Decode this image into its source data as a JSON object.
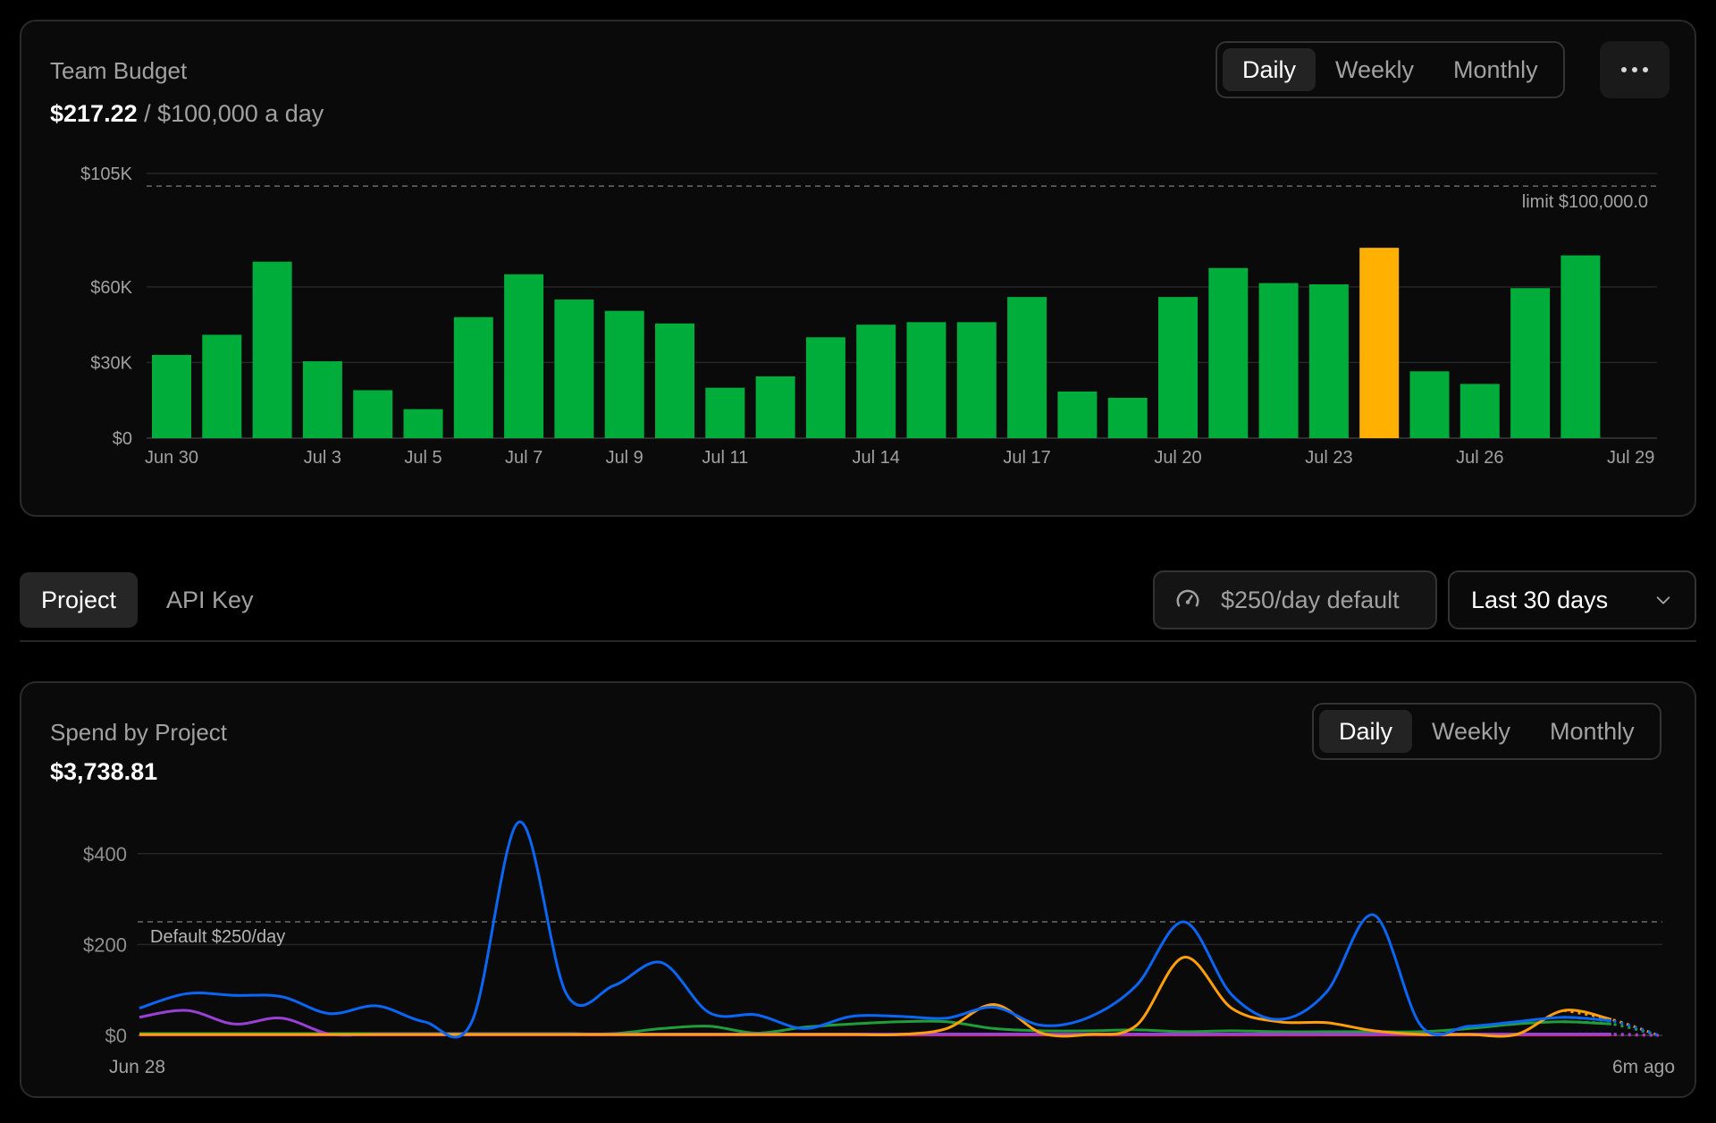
{
  "budget": {
    "title": "Team Budget",
    "spent": "$217.22",
    "separator": " / ",
    "limit_text": "$100,000 a day",
    "period_options": [
      "Daily",
      "Weekly",
      "Monthly"
    ],
    "active_period": "Daily",
    "more_icon": "ellipsis-icon"
  },
  "tabs": {
    "items": [
      "Project",
      "API Key"
    ],
    "active": "Project"
  },
  "limit_pill": {
    "label": "$250/day default",
    "icon": "gauge-icon"
  },
  "range_select": {
    "value": "Last 30 days",
    "icon": "chevron-down-icon"
  },
  "spend": {
    "title": "Spend by Project",
    "total": "$3,738.81",
    "period_options": [
      "Daily",
      "Weekly",
      "Monthly"
    ],
    "active_period": "Daily"
  },
  "colors": {
    "bar_normal": "#00ad3a",
    "bar_highlight": "#ffb000",
    "series_blue": "#0a66f5",
    "series_orange": "#ff9f0a",
    "series_purple": "#9b3fd6",
    "series_green": "#1f9e3a",
    "series_pink": "#e0227a"
  },
  "chart_data": [
    {
      "type": "bar",
      "categories": [
        "Jun 30",
        "Jul 1",
        "Jul 2",
        "Jul 3",
        "Jul 4",
        "Jul 5",
        "Jul 6",
        "Jul 7",
        "Jul 8",
        "Jul 9",
        "Jul 10",
        "Jul 11",
        "Jul 12",
        "Jul 13",
        "Jul 14",
        "Jul 15",
        "Jul 16",
        "Jul 17",
        "Jul 18",
        "Jul 19",
        "Jul 20",
        "Jul 21",
        "Jul 22",
        "Jul 23",
        "Jul 24",
        "Jul 25",
        "Jul 26",
        "Jul 27",
        "Jul 28",
        "Jul 29"
      ],
      "values": [
        33000,
        41000,
        70000,
        30500,
        19000,
        11500,
        48000,
        65000,
        55000,
        50500,
        45500,
        20000,
        24500,
        40000,
        45000,
        46000,
        46000,
        56000,
        18500,
        16000,
        56000,
        67500,
        61500,
        61000,
        75500,
        26500,
        21500,
        59500,
        72500,
        0
      ],
      "highlight_index": 24,
      "x_tick_labels": [
        "Jun 30",
        "Jul 3",
        "Jul 5",
        "Jul 7",
        "Jul 9",
        "Jul 11",
        "Jul 14",
        "Jul 17",
        "Jul 20",
        "Jul 23",
        "Jul 26",
        "Jul 29"
      ],
      "y_ticks": [
        {
          "value": 0,
          "label": "$0"
        },
        {
          "value": 30000,
          "label": "$30K"
        },
        {
          "value": 60000,
          "label": "$60K"
        },
        {
          "value": 105000,
          "label": "$105K"
        }
      ],
      "ylim": [
        0,
        105000
      ],
      "reference_line": {
        "value": 100000,
        "label": "limit $100,000.0"
      },
      "grid": true
    },
    {
      "type": "line",
      "x_start_label": "Jun 28",
      "x_end_label": "6m ago",
      "x_count": 33,
      "y_ticks": [
        {
          "value": 0,
          "label": "$0"
        },
        {
          "value": 200,
          "label": "$200"
        },
        {
          "value": 400,
          "label": "$400"
        }
      ],
      "ylim": [
        0,
        500
      ],
      "reference_line": {
        "value": 250,
        "label": "Default $250/day"
      },
      "grid": true,
      "series": [
        {
          "color_key": "series_blue",
          "values": [
            60,
            92,
            88,
            85,
            48,
            65,
            30,
            30,
            470,
            90,
            110,
            160,
            50,
            45,
            15,
            42,
            42,
            38,
            62,
            22,
            40,
            110,
            250,
            90,
            35,
            95,
            265,
            20,
            20,
            30,
            40,
            32,
            0
          ]
        },
        {
          "color_key": "series_orange",
          "values": [
            2,
            2,
            2,
            2,
            2,
            2,
            2,
            2,
            2,
            2,
            2,
            2,
            2,
            2,
            2,
            2,
            2,
            15,
            68,
            5,
            2,
            22,
            172,
            60,
            30,
            28,
            10,
            2,
            2,
            2,
            55,
            35,
            0
          ]
        },
        {
          "color_key": "series_purple",
          "values": [
            40,
            55,
            25,
            38,
            3,
            3,
            3,
            3,
            3,
            3,
            3,
            3,
            3,
            3,
            3,
            3,
            3,
            3,
            3,
            3,
            3,
            3,
            3,
            3,
            3,
            3,
            3,
            3,
            3,
            3,
            3,
            3,
            0
          ]
        },
        {
          "color_key": "series_green",
          "values": [
            4,
            4,
            4,
            4,
            4,
            4,
            4,
            4,
            4,
            4,
            4,
            15,
            20,
            5,
            18,
            25,
            30,
            30,
            15,
            10,
            10,
            12,
            8,
            10,
            8,
            8,
            8,
            8,
            15,
            25,
            30,
            25,
            0
          ]
        },
        {
          "color_key": "series_pink",
          "values": [
            1,
            1,
            1,
            1,
            1,
            1,
            1,
            1,
            1,
            1,
            1,
            1,
            1,
            1,
            1,
            1,
            1,
            1,
            1,
            1,
            1,
            1,
            1,
            1,
            1,
            1,
            1,
            1,
            1,
            1,
            1,
            1,
            0
          ]
        }
      ]
    }
  ]
}
